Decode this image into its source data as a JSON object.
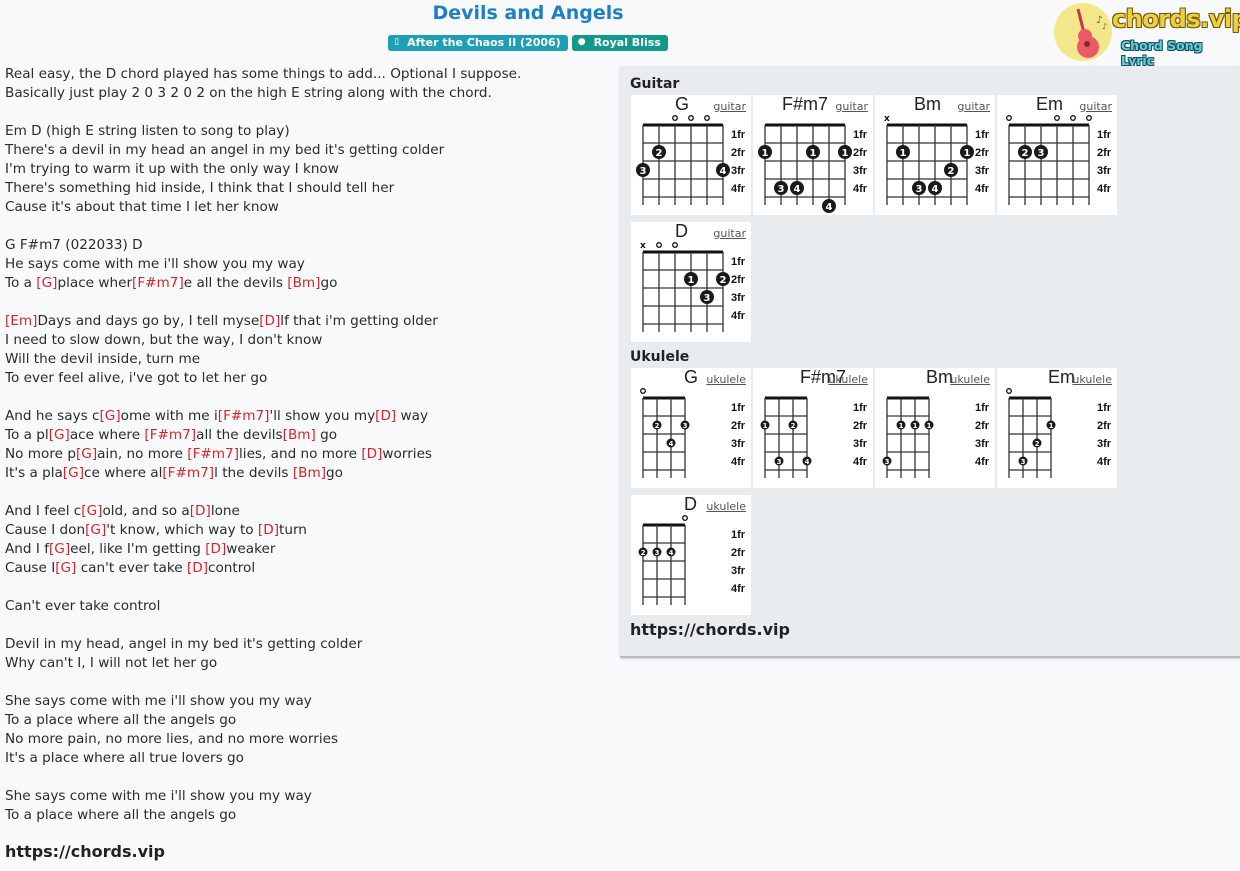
{
  "page": {
    "title": "Devils and Angels",
    "album_badge": "After the Chaos II (2006)",
    "artist_badge": "Royal Bliss",
    "album_icon": "book-icon",
    "artist_icon": "user-icon"
  },
  "logo": {
    "brand": "chords.vip",
    "tagline": "Chord Song Lyric",
    "icon": "guitar-icon"
  },
  "lyrics": [
    [
      {
        "t": "Real easy, the D chord played has some things to add... Optional I suppose."
      }
    ],
    [
      {
        "t": "Basically just play 2 0 3 2 0 2 on the high E string along with the chord."
      }
    ],
    [],
    [
      {
        "t": "Em D (high E string listen to song to play)"
      }
    ],
    [
      {
        "t": "There's a devil in my head an angel in my bed it's getting colder"
      }
    ],
    [
      {
        "t": "I'm trying to warm it up with the only way I know"
      }
    ],
    [
      {
        "t": "There's something hid inside, I think that I should tell her"
      }
    ],
    [
      {
        "t": "Cause it's about that time I let her know"
      }
    ],
    [],
    [
      {
        "t": "G F#m7 (022033) D"
      }
    ],
    [
      {
        "t": "He says come with me i'll show you my way"
      }
    ],
    [
      {
        "t": "To a "
      },
      {
        "c": "[G]"
      },
      {
        "t": "place wher"
      },
      {
        "c": "[F#m7]"
      },
      {
        "t": "e all the devils "
      },
      {
        "c": "[Bm]"
      },
      {
        "t": "go"
      }
    ],
    [],
    [
      {
        "c": "[Em]"
      },
      {
        "t": "Days and days go by, I tell myse"
      },
      {
        "c": "[D]"
      },
      {
        "t": "lf that i'm getting older"
      }
    ],
    [
      {
        "t": "I need to slow down, but the way, I don't know"
      }
    ],
    [
      {
        "t": "Will the devil inside, turn me"
      }
    ],
    [
      {
        "t": "To ever feel alive, i've got to let her go"
      }
    ],
    [],
    [
      {
        "t": "And he says c"
      },
      {
        "c": "[G]"
      },
      {
        "t": "ome with me i"
      },
      {
        "c": "[F#m7]"
      },
      {
        "t": "'ll show you my"
      },
      {
        "c": "[D]"
      },
      {
        "t": " way"
      }
    ],
    [
      {
        "t": "To a pl"
      },
      {
        "c": "[G]"
      },
      {
        "t": "ace where "
      },
      {
        "c": "[F#m7]"
      },
      {
        "t": "all the devils"
      },
      {
        "c": "[Bm]"
      },
      {
        "t": " go"
      }
    ],
    [
      {
        "t": "No more p"
      },
      {
        "c": "[G]"
      },
      {
        "t": "ain, no more "
      },
      {
        "c": "[F#m7]"
      },
      {
        "t": "lies, and no more "
      },
      {
        "c": "[D]"
      },
      {
        "t": "worries"
      }
    ],
    [
      {
        "t": "It's a pla"
      },
      {
        "c": "[G]"
      },
      {
        "t": "ce where al"
      },
      {
        "c": "[F#m7]"
      },
      {
        "t": "l the devils "
      },
      {
        "c": "[Bm]"
      },
      {
        "t": "go"
      }
    ],
    [],
    [
      {
        "t": "And I feel c"
      },
      {
        "c": "[G]"
      },
      {
        "t": "old, and so a"
      },
      {
        "c": "[D]"
      },
      {
        "t": "lone"
      }
    ],
    [
      {
        "t": "Cause I don"
      },
      {
        "c": "[G]"
      },
      {
        "t": "'t know, which way to "
      },
      {
        "c": "[D]"
      },
      {
        "t": "turn"
      }
    ],
    [
      {
        "t": "And I f"
      },
      {
        "c": "[G]"
      },
      {
        "t": "eel, like I'm getting "
      },
      {
        "c": "[D]"
      },
      {
        "t": "weaker"
      }
    ],
    [
      {
        "t": "Cause I"
      },
      {
        "c": "[G]"
      },
      {
        "t": " can't ever take "
      },
      {
        "c": "[D]"
      },
      {
        "t": "control"
      }
    ],
    [],
    [
      {
        "t": "Can't ever take control"
      }
    ],
    [],
    [
      {
        "t": "Devil in my head, angel in my bed it's getting colder"
      }
    ],
    [
      {
        "t": "Why can't I, I will not let her go"
      }
    ],
    [],
    [
      {
        "t": "She says come with me i'll show you my way"
      }
    ],
    [
      {
        "t": "To a place where all the angels go"
      }
    ],
    [
      {
        "t": "No more pain, no more lies, and no more worries"
      }
    ],
    [
      {
        "t": "It's a place where all true lovers go"
      }
    ],
    [],
    [
      {
        "t": "She says come with me i'll show you my way"
      }
    ],
    [
      {
        "t": "To a place where all the angels go"
      }
    ]
  ],
  "footer_url": "https://chords.vip",
  "panel": {
    "guitar_title": "Guitar",
    "ukulele_title": "Ukulele",
    "url": "https://chords.vip",
    "fret_labels": [
      "1fr",
      "2fr",
      "3fr",
      "4fr"
    ],
    "guitar": [
      {
        "name": "G",
        "link": "guitar",
        "open": [
          2,
          3,
          4
        ],
        "muted": [],
        "dots": [
          {
            "s": 1,
            "f": 2,
            "n": "2"
          },
          {
            "s": 0,
            "f": 3,
            "n": "3"
          },
          {
            "s": 5,
            "f": 3,
            "n": "4"
          }
        ]
      },
      {
        "name": "F#m7",
        "link": "guitar",
        "open": [],
        "muted": [],
        "dots": [
          {
            "s": 0,
            "f": 2,
            "n": "1"
          },
          {
            "s": 3,
            "f": 2,
            "n": "1"
          },
          {
            "s": 5,
            "f": 2,
            "n": "1"
          },
          {
            "s": 1,
            "f": 4,
            "n": "3"
          },
          {
            "s": 2,
            "f": 4,
            "n": "4"
          },
          {
            "s": 4,
            "f": 5,
            "n": "4"
          }
        ]
      },
      {
        "name": "Bm",
        "link": "guitar",
        "open": [],
        "muted": [
          0
        ],
        "dots": [
          {
            "s": 1,
            "f": 2,
            "n": "1"
          },
          {
            "s": 5,
            "f": 2,
            "n": "1"
          },
          {
            "s": 4,
            "f": 3,
            "n": "2"
          },
          {
            "s": 2,
            "f": 4,
            "n": "3"
          },
          {
            "s": 3,
            "f": 4,
            "n": "4"
          }
        ]
      },
      {
        "name": "Em",
        "link": "guitar",
        "open": [
          0,
          3,
          4,
          5
        ],
        "muted": [],
        "dots": [
          {
            "s": 1,
            "f": 2,
            "n": "2"
          },
          {
            "s": 2,
            "f": 2,
            "n": "3"
          }
        ]
      },
      {
        "name": "D",
        "link": "guitar",
        "open": [
          1,
          2
        ],
        "muted": [
          0
        ],
        "dots": [
          {
            "s": 3,
            "f": 2,
            "n": "1"
          },
          {
            "s": 5,
            "f": 2,
            "n": "2"
          },
          {
            "s": 4,
            "f": 3,
            "n": "3"
          }
        ]
      }
    ],
    "ukulele": [
      {
        "name": "G",
        "link": "ukulele",
        "open": [
          0
        ],
        "muted": [],
        "dots": [
          {
            "s": 1,
            "f": 2,
            "n": "2"
          },
          {
            "s": 3,
            "f": 2,
            "n": "3"
          },
          {
            "s": 2,
            "f": 3,
            "n": "4"
          }
        ]
      },
      {
        "name": "F#m7",
        "link": "ukulele",
        "open": [],
        "muted": [],
        "dots": [
          {
            "s": 0,
            "f": 2,
            "n": "1"
          },
          {
            "s": 2,
            "f": 2,
            "n": "2"
          },
          {
            "s": 1,
            "f": 4,
            "n": "3"
          },
          {
            "s": 3,
            "f": 4,
            "n": "4"
          }
        ]
      },
      {
        "name": "Bm",
        "link": "ukulele",
        "open": [],
        "muted": [],
        "dots": [
          {
            "s": 1,
            "f": 2,
            "n": "1"
          },
          {
            "s": 2,
            "f": 2,
            "n": "1"
          },
          {
            "s": 3,
            "f": 2,
            "n": "1"
          },
          {
            "s": 0,
            "f": 4,
            "n": "3"
          }
        ]
      },
      {
        "name": "Em",
        "link": "ukulele",
        "open": [
          0
        ],
        "muted": [],
        "dots": [
          {
            "s": 3,
            "f": 2,
            "n": "1"
          },
          {
            "s": 2,
            "f": 3,
            "n": "2"
          },
          {
            "s": 1,
            "f": 4,
            "n": "3"
          }
        ]
      },
      {
        "name": "D",
        "link": "ukulele",
        "open": [
          3
        ],
        "muted": [],
        "dots": [
          {
            "s": 0,
            "f": 2,
            "n": "2"
          },
          {
            "s": 1,
            "f": 2,
            "n": "3"
          },
          {
            "s": 2,
            "f": 2,
            "n": "4"
          }
        ]
      }
    ]
  }
}
